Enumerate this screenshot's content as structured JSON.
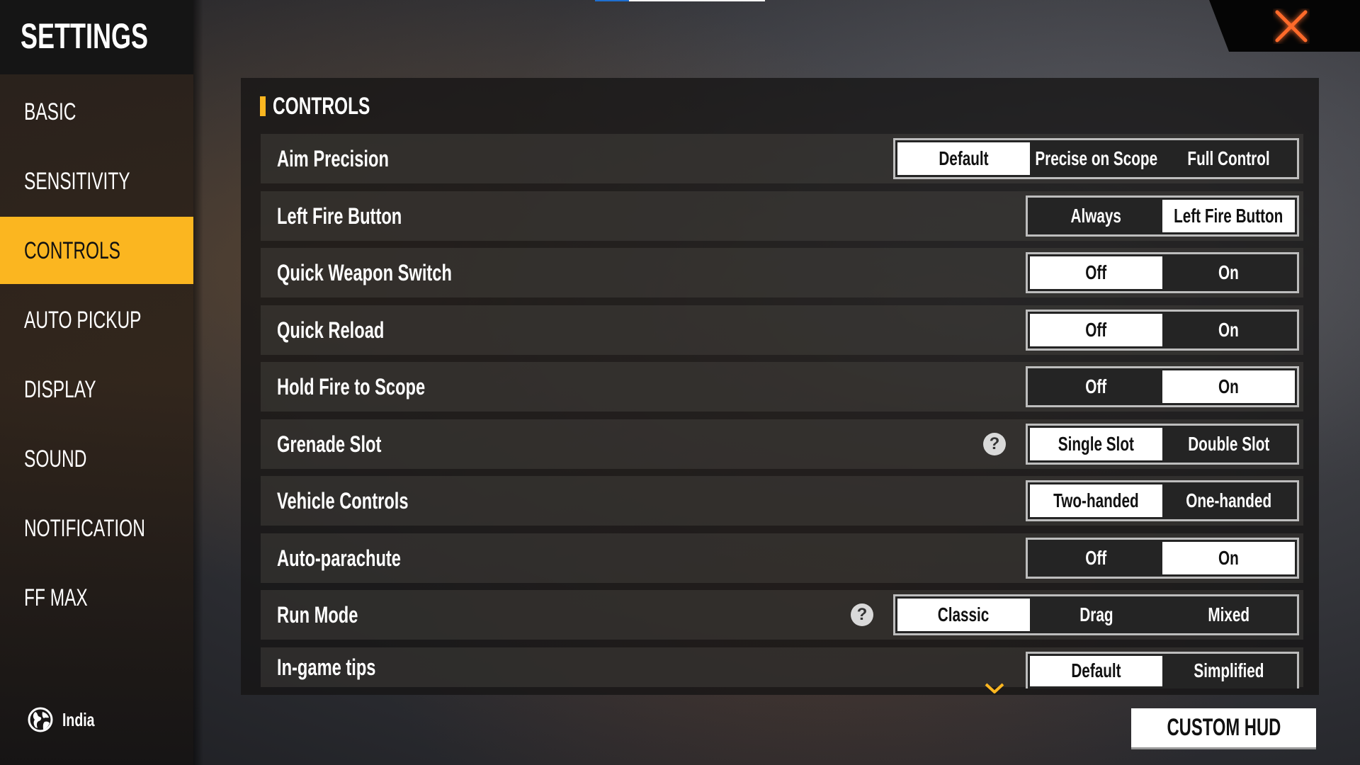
{
  "colors": {
    "accent": "#fbb620",
    "close": "#ff6a2a",
    "selected_bg": "#ffffff",
    "unselected_bg": "#242424"
  },
  "header": {
    "title": "SETTINGS"
  },
  "sidebar": {
    "items": [
      {
        "label": "BASIC",
        "active": false
      },
      {
        "label": "SENSITIVITY",
        "active": false
      },
      {
        "label": "CONTROLS",
        "active": true
      },
      {
        "label": "AUTO PICKUP",
        "active": false
      },
      {
        "label": "DISPLAY",
        "active": false
      },
      {
        "label": "SOUND",
        "active": false
      },
      {
        "label": "NOTIFICATION",
        "active": false
      },
      {
        "label": "FF MAX",
        "active": false
      }
    ],
    "region": {
      "icon": "globe-icon",
      "label": "India"
    }
  },
  "close_button": {
    "icon": "close-icon"
  },
  "panel": {
    "title": "CONTROLS",
    "rows": [
      {
        "label": "Aim Precision",
        "help": false,
        "options": [
          "Default",
          "Precise on Scope",
          "Full Control"
        ],
        "selected": 0
      },
      {
        "label": "Left Fire Button",
        "help": false,
        "options": [
          "Always",
          "Left Fire Button"
        ],
        "selected": 1
      },
      {
        "label": "Quick Weapon Switch",
        "help": false,
        "options": [
          "Off",
          "On"
        ],
        "selected": 0
      },
      {
        "label": "Quick Reload",
        "help": false,
        "options": [
          "Off",
          "On"
        ],
        "selected": 0
      },
      {
        "label": "Hold Fire to Scope",
        "help": false,
        "options": [
          "Off",
          "On"
        ],
        "selected": 1
      },
      {
        "label": "Grenade Slot",
        "help": true,
        "options": [
          "Single Slot",
          "Double Slot"
        ],
        "selected": 0
      },
      {
        "label": "Vehicle Controls",
        "help": false,
        "options": [
          "Two-handed",
          "One-handed"
        ],
        "selected": 0
      },
      {
        "label": "Auto-parachute",
        "help": false,
        "options": [
          "Off",
          "On"
        ],
        "selected": 1
      },
      {
        "label": "Run Mode",
        "help": true,
        "options": [
          "Classic",
          "Drag",
          "Mixed"
        ],
        "selected": 0
      },
      {
        "label": "In-game tips",
        "help": false,
        "options": [
          "Default",
          "Simplified"
        ],
        "selected": 0
      }
    ],
    "help_glyph": "?",
    "scroll_icon": "chevron-down-icon"
  },
  "footer": {
    "custom_hud_label": "CUSTOM HUD"
  }
}
